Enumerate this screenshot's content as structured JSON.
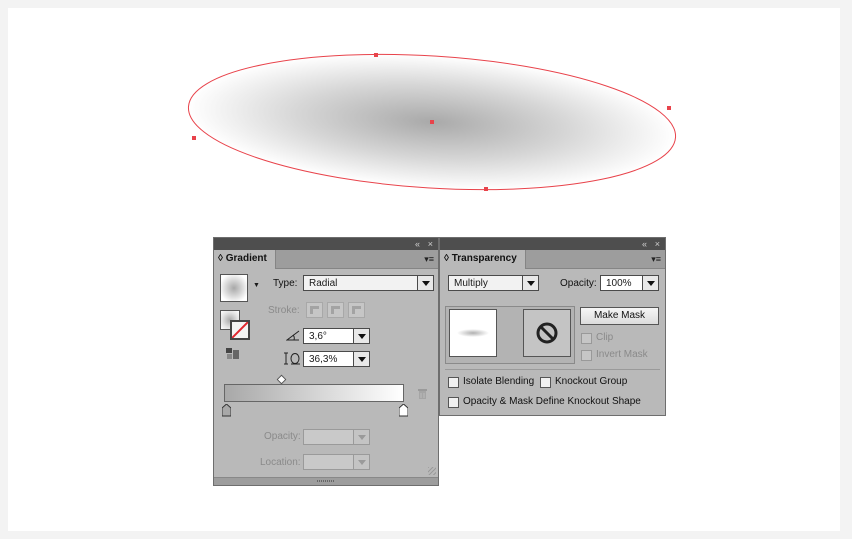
{
  "canvas": {
    "background": "#ffffff",
    "selection_color": "#e8434b"
  },
  "gradient_panel": {
    "title": "Gradient",
    "topbar_collapse": "«",
    "topbar_close": "×",
    "menu_icon": "panel-menu-icon",
    "type_label": "Type:",
    "type_value": "Radial",
    "stroke_label": "Stroke:",
    "angle_value": "3,6°",
    "aspect_value": "36,3%",
    "opacity_label": "Opacity:",
    "opacity_value": "",
    "location_label": "Location:",
    "location_value": "",
    "slider_start_color": "#a8a8a8",
    "slider_end_color": "#ffffff"
  },
  "transparency_panel": {
    "title": "Transparency",
    "topbar_collapse": "«",
    "topbar_close": "×",
    "blend_mode_value": "Multiply",
    "opacity_label": "Opacity:",
    "opacity_value": "100%",
    "make_mask_label": "Make Mask",
    "clip_label": "Clip",
    "invert_mask_label": "Invert Mask",
    "isolate_blending_label": "Isolate Blending",
    "knockout_group_label": "Knockout Group",
    "opacity_mask_knockout_label": "Opacity & Mask Define Knockout Shape"
  }
}
